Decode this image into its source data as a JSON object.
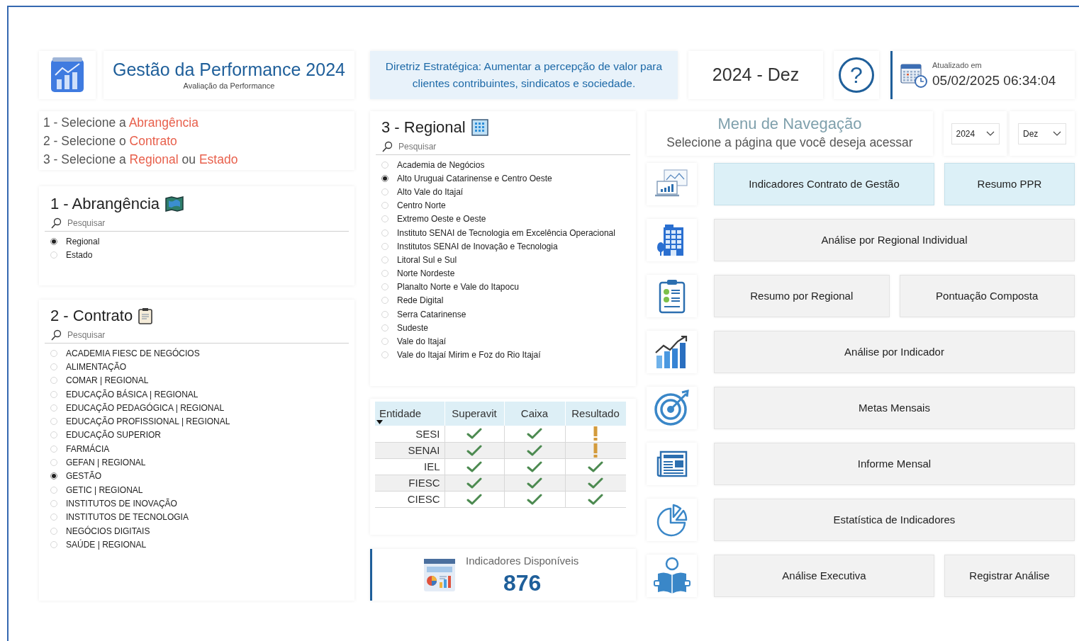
{
  "header": {
    "title": "Gestão da Performance 2024",
    "subtitle": "Avaliação da Performance"
  },
  "directive": "Diretriz Estratégica: Aumentar a percepção de valor para clientes contribuintes, sindicatos e sociedade.",
  "period": "2024 - Dez",
  "help_button": {
    "label": "?"
  },
  "updated": {
    "label": "Atualizado em",
    "value": "05/02/2025 06:34:04"
  },
  "instructions": [
    [
      {
        "text": "1 - Selecione a ",
        "highlight": false
      },
      {
        "text": "Abrangência",
        "highlight": true
      }
    ],
    [
      {
        "text": "2 - Selecione o ",
        "highlight": false
      },
      {
        "text": "Contrato",
        "highlight": true
      }
    ],
    [
      {
        "text": "3 - Selecione a ",
        "highlight": false
      },
      {
        "text": "Regional",
        "highlight": true
      },
      {
        "text": " ou ",
        "highlight": false
      },
      {
        "text": "Estado",
        "highlight": true
      }
    ]
  ],
  "slicers": [
    {
      "title": "1 - Abrangência",
      "search_placeholder": "Pesquisar",
      "items": [
        {
          "label": "Regional",
          "selected": true
        },
        {
          "label": "Estado",
          "selected": false
        }
      ]
    },
    {
      "title": "2 - Contrato",
      "search_placeholder": "Pesquisar",
      "items": [
        {
          "label": "ACADEMIA FIESC DE NEGÓCIOS",
          "selected": false
        },
        {
          "label": "ALIMENTAÇÃO",
          "selected": false
        },
        {
          "label": "COMAR | REGIONAL",
          "selected": false
        },
        {
          "label": "EDUCAÇÃO BÁSICA | REGIONAL",
          "selected": false
        },
        {
          "label": "EDUCAÇÃO PEDAGÓGICA | REGIONAL",
          "selected": false
        },
        {
          "label": "EDUCAÇÃO PROFISSIONAL | REGIONAL",
          "selected": false
        },
        {
          "label": "EDUCAÇÃO SUPERIOR",
          "selected": false
        },
        {
          "label": "FARMÁCIA",
          "selected": false
        },
        {
          "label": "GEFAN | REGIONAL",
          "selected": false
        },
        {
          "label": "GESTÃO",
          "selected": true
        },
        {
          "label": "GETIC | REGIONAL",
          "selected": false
        },
        {
          "label": "INSTITUTOS DE INOVAÇÃO",
          "selected": false
        },
        {
          "label": "INSTITUTOS DE TECNOLOGIA",
          "selected": false
        },
        {
          "label": "NEGÓCIOS DIGITAIS",
          "selected": false
        },
        {
          "label": "SAÚDE | REGIONAL",
          "selected": false
        }
      ]
    },
    {
      "title": "3 - Regional",
      "search_placeholder": "Pesquisar",
      "items": [
        {
          "label": "Academia de Negócios",
          "selected": false
        },
        {
          "label": "Alto Uruguai Catarinense e Centro Oeste",
          "selected": true
        },
        {
          "label": "Alto Vale do Itajaí",
          "selected": false
        },
        {
          "label": "Centro Norte",
          "selected": false
        },
        {
          "label": "Extremo Oeste e Oeste",
          "selected": false
        },
        {
          "label": "Instituto SENAI de Tecnologia em Excelência Operacional",
          "selected": false
        },
        {
          "label": "Institutos SENAI de Inovação e Tecnologia",
          "selected": false
        },
        {
          "label": "Litoral Sul e Sul",
          "selected": false
        },
        {
          "label": "Norte Nordeste",
          "selected": false
        },
        {
          "label": "Planalto Norte e Vale do Itapocu",
          "selected": false
        },
        {
          "label": "Rede Digital",
          "selected": false
        },
        {
          "label": "Serra Catarinense",
          "selected": false
        },
        {
          "label": "Sudeste",
          "selected": false
        },
        {
          "label": "Vale do Itajaí",
          "selected": false
        },
        {
          "label": "Vale do Itajaí Mirim e Foz do Rio Itajaí",
          "selected": false
        }
      ]
    }
  ],
  "table": {
    "columns": [
      "Entidade",
      "Superavit",
      "Caixa",
      "Resultado"
    ],
    "rows": [
      {
        "entity": "SESI",
        "cells": [
          {
            "kind": "check"
          },
          {
            "kind": "check"
          },
          {
            "kind": "warning"
          }
        ]
      },
      {
        "entity": "SENAI",
        "cells": [
          {
            "kind": "check"
          },
          {
            "kind": "check"
          },
          {
            "kind": "warning"
          }
        ]
      },
      {
        "entity": "IEL",
        "cells": [
          {
            "kind": "check"
          },
          {
            "kind": "check"
          },
          {
            "kind": "check"
          }
        ]
      },
      {
        "entity": "FIESC",
        "cells": [
          {
            "kind": "check"
          },
          {
            "kind": "check"
          },
          {
            "kind": "check"
          }
        ]
      },
      {
        "entity": "CIESC",
        "cells": [
          {
            "kind": "check"
          },
          {
            "kind": "check"
          },
          {
            "kind": "check"
          }
        ]
      }
    ]
  },
  "kpi": {
    "label": "Indicadores Disponíveis",
    "value": "876"
  },
  "nav": {
    "title": "Menu de Navegação",
    "subtitle": "Selecione a página que você deseja acessar",
    "filters": [
      {
        "value": "2024"
      },
      {
        "value": "Dez"
      }
    ],
    "rows": [
      {
        "buttons": [
          {
            "label": "Indicadores Contrato de Gestão",
            "highlighted": true
          },
          {
            "label": "Resumo PPR",
            "highlighted": true
          }
        ]
      },
      {
        "buttons": [
          {
            "label": "Análise por Regional Individual",
            "highlighted": false
          }
        ]
      },
      {
        "buttons": [
          {
            "label": "Resumo por Regional",
            "highlighted": false
          },
          {
            "label": "Pontuação Composta",
            "highlighted": false
          }
        ]
      },
      {
        "buttons": [
          {
            "label": "Análise por Indicador",
            "highlighted": false
          }
        ]
      },
      {
        "buttons": [
          {
            "label": "Metas Mensais",
            "highlighted": false
          }
        ]
      },
      {
        "buttons": [
          {
            "label": "Informe Mensal",
            "highlighted": false
          }
        ]
      },
      {
        "buttons": [
          {
            "label": "Estatística de Indicadores",
            "highlighted": false
          }
        ]
      },
      {
        "buttons": [
          {
            "label": "Análise Executiva",
            "highlighted": false
          },
          {
            "label": "Registrar Análise",
            "highlighted": false
          }
        ]
      }
    ]
  }
}
